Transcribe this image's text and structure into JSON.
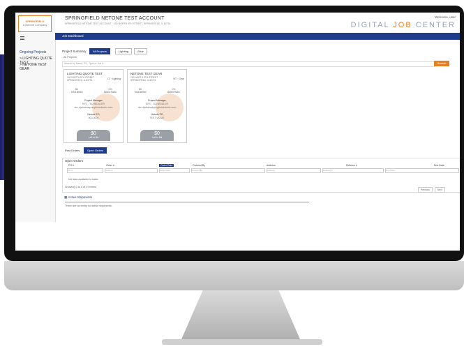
{
  "app": {
    "account_title": "SPRINGFIELD NETONE TEST ACCOUNT",
    "account_address": "SPRINGFIELD NETONE TEST ACCOUNT · 100 NORTH 9TH STREET, SPRINGFIELD, IL 62701",
    "welcome": "Welcome, user",
    "brand_left": "DIGITAL",
    "brand_mid": "JOB",
    "brand_right": "CENTER",
    "logo_line1": "SPRINGFIELD",
    "logo_line2": "A Netone Company",
    "nav_label": "Job Dashboard"
  },
  "sidebar": {
    "menu_icon": "hamburger-icon",
    "heading": "Ongoing Projects",
    "items": [
      {
        "label": "> LIGHTING QUOTE TEST"
      },
      {
        "label": "> NETONE TEST GEAR"
      }
    ]
  },
  "project_summary": {
    "label": "Project Summary",
    "tabs": [
      {
        "label": "All Projects",
        "active": true
      },
      {
        "label": "Lighting",
        "active": false
      },
      {
        "label": "Gear",
        "active": false
      }
    ],
    "filter_label": "All Projects",
    "search_placeholder": "Search by Name, PO, Type or Job #...",
    "search_button": "Search"
  },
  "cards": [
    {
      "name": "LIGHTING QUOTE TEST",
      "address": "100 NORTH 9TH STREET SPRINGFIELD, IL 62701",
      "tag": "LT · Lighting",
      "stat1_value": "$0",
      "stat1_label": "Total Billed",
      "stat2_value": "0%",
      "stat2_label": "Billed Ratio",
      "pm_label": "Project Manager",
      "pm_name": "RPC - SCHEDULER",
      "pm_email": "dcc.djwhatsaspringfieldelectric.com",
      "po_label": "Netone PO",
      "po_value": "000-0000",
      "amount": "$0",
      "amount_label": "Left to Bill"
    },
    {
      "name": "NETONE TEST GEAR",
      "address": "100 NORTH 9TH STREET SPRINGFIELD, IL 62701",
      "tag": "NT · Gear",
      "stat1_value": "$0",
      "stat1_label": "Total Billed",
      "stat2_value": "0%",
      "stat2_label": "Billed Ratio",
      "pm_label": "Project Manager",
      "pm_name": "RPC - SCHEDULER",
      "pm_email": "dcc.djwhatsaspringfieldelectric.com",
      "po_label": "Netone PO",
      "po_value": "TEST VALUE",
      "amount": "$0",
      "amount_label": "Left to Bill"
    }
  ],
  "orders": {
    "tabs": [
      {
        "label": "Past Orders",
        "active": false
      },
      {
        "label": "Open Orders",
        "active": true
      }
    ],
    "title": "Open Orders",
    "columns": [
      "PO #",
      "Order #",
      "Order Date",
      "Ordered By",
      "Address",
      "Release #",
      "Due Date"
    ],
    "filters": [
      "PO #",
      "Order #",
      "Order Date",
      "Ordered By",
      "Address",
      "Release #",
      "Due Date"
    ],
    "empty_text": "No data available in table",
    "showing_text": "Showing 0 to 0 of 0 entries",
    "prev_label": "Previous",
    "next_label": "Next"
  },
  "shipments": {
    "title": "Active Shipments",
    "empty_text": "There are currently no active shipments."
  },
  "colors": {
    "accent_blue": "#1f3c8c",
    "accent_orange": "#e67e22"
  }
}
